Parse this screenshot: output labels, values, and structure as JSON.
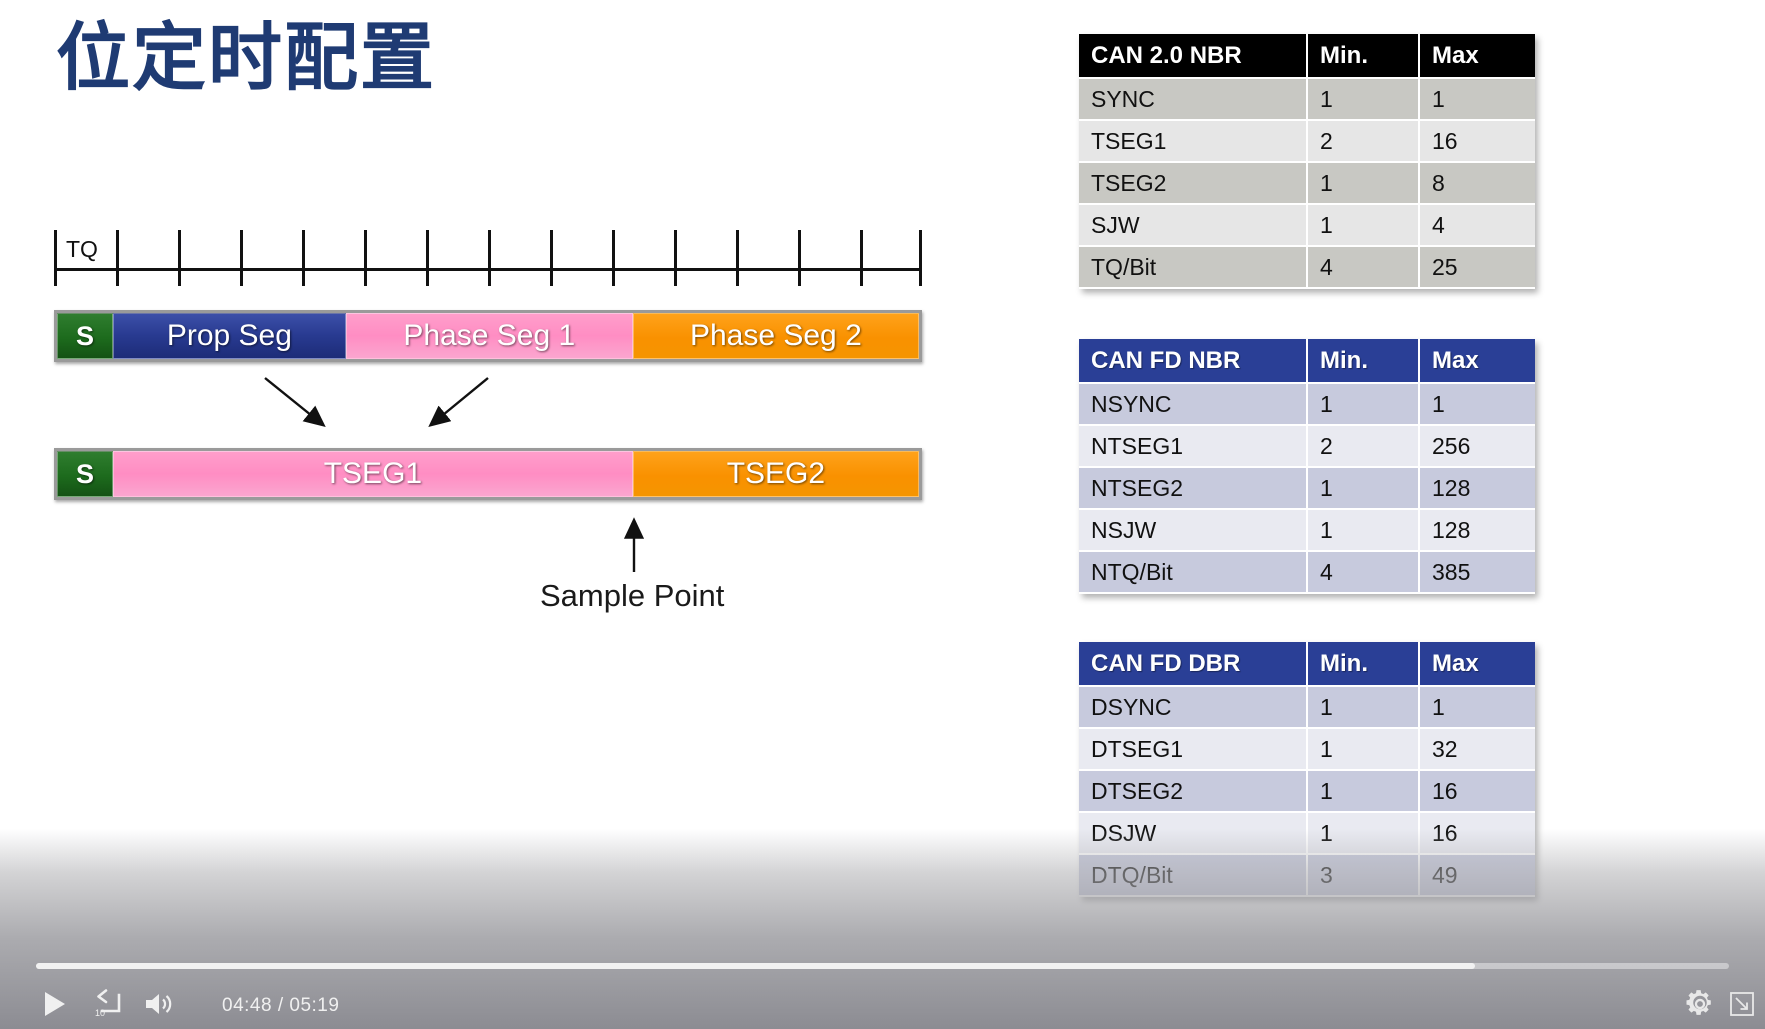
{
  "slide": {
    "title": "位定时配置",
    "tq_ruler": {
      "label": "TQ",
      "tick_count": 14
    },
    "bit_segments_row1": [
      {
        "label": "S",
        "key": "sync",
        "width_pct": 6.5
      },
      {
        "label": "Prop Seg",
        "key": "prop",
        "width_pct": 27.0
      },
      {
        "label": "Phase Seg 1",
        "key": "phase1",
        "width_pct": 33.3
      },
      {
        "label": "Phase Seg 2",
        "key": "phase2",
        "width_pct": 33.2
      }
    ],
    "bit_segments_row2": [
      {
        "label": "S",
        "key": "sync",
        "width_pct": 6.5
      },
      {
        "label": "TSEG1",
        "key": "tseg1",
        "width_pct": 60.3
      },
      {
        "label": "TSEG2",
        "key": "tseg2",
        "width_pct": 33.2
      }
    ],
    "annotation": {
      "sample_point": "Sample Point"
    }
  },
  "tables": [
    {
      "id": "can20",
      "headers": [
        "CAN 2.0 NBR",
        "Min.",
        "Max"
      ],
      "header_style": "black",
      "header_color": "#000000",
      "rows": [
        [
          "SYNC",
          "1",
          "1"
        ],
        [
          "TSEG1",
          "2",
          "16"
        ],
        [
          "TSEG2",
          "1",
          "8"
        ],
        [
          "SJW",
          "1",
          "4"
        ],
        [
          "TQ/Bit",
          "4",
          "25"
        ]
      ]
    },
    {
      "id": "canfd_nbr",
      "headers": [
        "CAN FD NBR",
        "Min.",
        "Max"
      ],
      "header_style": "blue",
      "header_color": "#2a3f96",
      "rows": [
        [
          "NSYNC",
          "1",
          "1"
        ],
        [
          "NTSEG1",
          "2",
          "256"
        ],
        [
          "NTSEG2",
          "1",
          "128"
        ],
        [
          "NSJW",
          "1",
          "128"
        ],
        [
          "NTQ/Bit",
          "4",
          "385"
        ]
      ]
    },
    {
      "id": "canfd_dbr",
      "headers": [
        "CAN FD DBR",
        "Min.",
        "Max"
      ],
      "header_style": "blue",
      "header_color": "#2a3f96",
      "rows": [
        [
          "DSYNC",
          "1",
          "1"
        ],
        [
          "DTSEG1",
          "1",
          "32"
        ],
        [
          "DTSEG2",
          "1",
          "16"
        ],
        [
          "DSJW",
          "1",
          "16"
        ],
        [
          "DTQ/Bit",
          "3",
          "49"
        ]
      ]
    }
  ],
  "player": {
    "current_time": "04:48",
    "total_time": "05:19",
    "time_separator": "/",
    "time_display": "04:48  /  05:19",
    "progress_percent": 85,
    "controls": {
      "play": "play-button",
      "rewind": "rewind-10-seconds",
      "rewind_label": "10",
      "volume": "volume-button",
      "settings": "settings-gear",
      "fullscreen": "exit-fullscreen"
    }
  }
}
